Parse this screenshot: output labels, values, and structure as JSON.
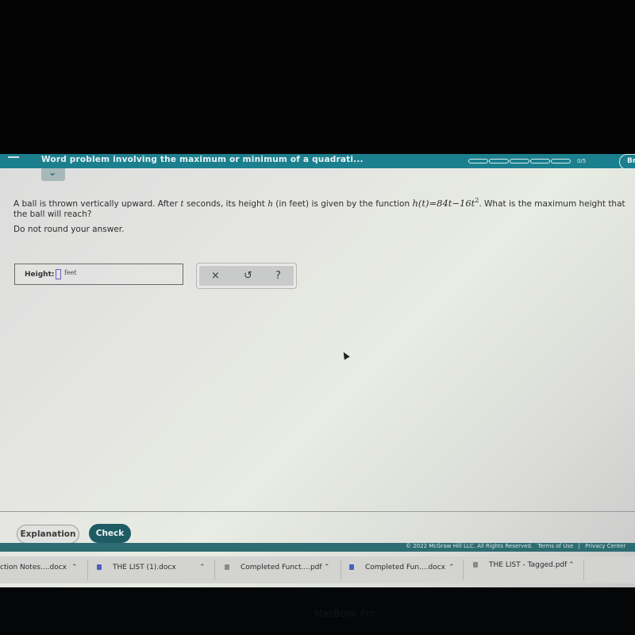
{
  "header": {
    "topic_title": "Word problem involving the maximum or minimum of a quadrati...",
    "progress": {
      "completed": 0,
      "total": 5,
      "label": "0/5"
    },
    "right_button_label": "Br",
    "collapse_icon": "chevron-down-icon",
    "menu_icon": "hamburger-icon"
  },
  "question": {
    "text_before_t": "A ball is thrown vertically upward. After ",
    "var_t": "t",
    "text_before_h": " seconds, its height ",
    "var_h": "h",
    "text_after_h": " (in feet) is given by the function ",
    "function_expression": "h(t)=84t−16t",
    "function_exponent": "2",
    "text_after_function": ". What is the maximum height that the ball will reach?",
    "instruction": "Do not round your answer."
  },
  "answer": {
    "label": "Height:",
    "value": "",
    "unit": "feet"
  },
  "tools": {
    "clear_icon": "×",
    "undo_icon": "↺",
    "help_icon": "?"
  },
  "actions": {
    "explanation_label": "Explanation",
    "check_label": "Check"
  },
  "footer": {
    "copyright": "© 2022 McGraw Hill LLC. All Rights Reserved.",
    "terms": "Terms of Use",
    "separator": "|",
    "privacy": "Privacy Center"
  },
  "downloads": [
    {
      "name": "ction Notes....docx",
      "type": "docx"
    },
    {
      "name": "THE LIST (1).docx",
      "type": "docx"
    },
    {
      "name": "Completed Funct....pdf",
      "type": "pdf"
    },
    {
      "name": "Completed Fun....docx",
      "type": "docx"
    },
    {
      "name": "THE LIST - Tagged.pdf",
      "type": "pdf"
    }
  ],
  "device": {
    "bezel_label": "MacBook Pro"
  },
  "colors": {
    "topbar": "#1b7f8e",
    "check_button": "#1e5b62",
    "footer": "#2d6c72",
    "input_border": "#6b5db8"
  }
}
